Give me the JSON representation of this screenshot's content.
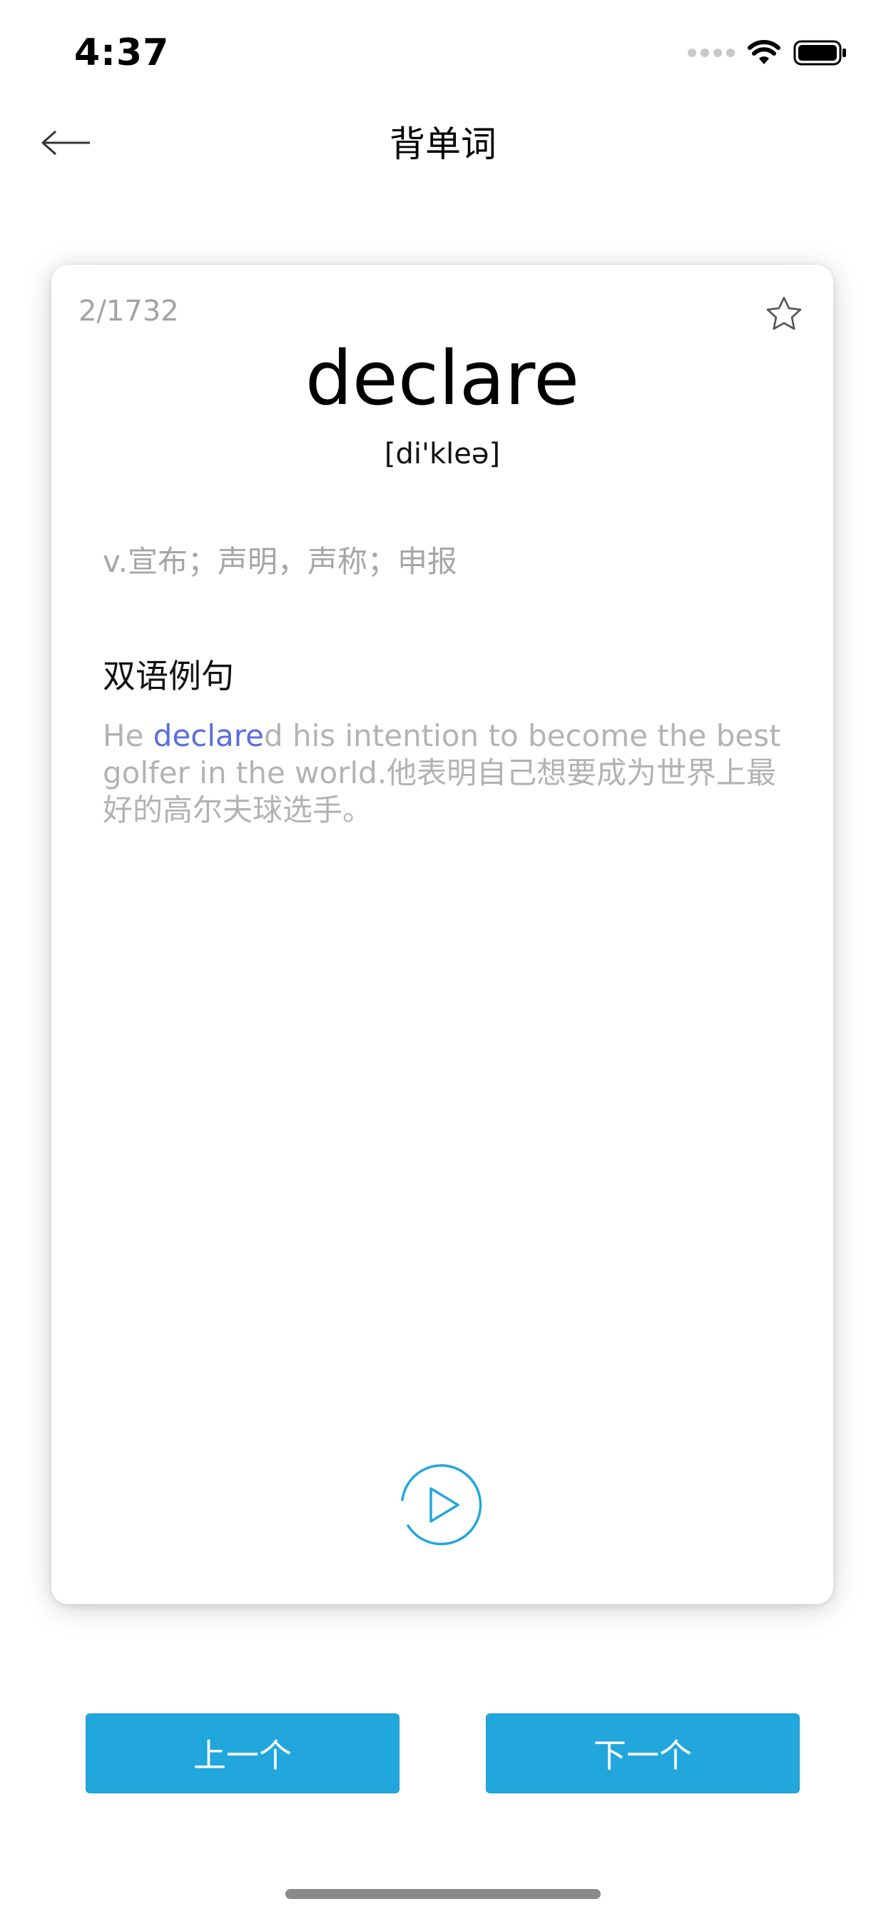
{
  "status_bar": {
    "time": "4:37"
  },
  "nav": {
    "title": "背单词"
  },
  "card": {
    "progress": "2/1732",
    "word": "declare",
    "phonetic": "[di'kleə]",
    "definition": "v.宣布；声明，声称；申报",
    "examples_title": "双语例句",
    "example": {
      "prefix": "He ",
      "highlight": "declare",
      "rest": "d his intention to become the best golfer in the world.他表明自己想要成为世界上最好的高尔夫球选手。"
    }
  },
  "buttons": {
    "prev_label": "上一个",
    "next_label": "下一个"
  },
  "icons": {
    "back": "arrow-left-icon",
    "favorite": "star-outline-icon",
    "play": "play-circle-icon",
    "wifi": "wifi-icon",
    "battery": "battery-icon"
  },
  "colors": {
    "accent": "#22a7dd",
    "highlight": "#5a6ee0",
    "muted_text": "#a6a6a6"
  }
}
